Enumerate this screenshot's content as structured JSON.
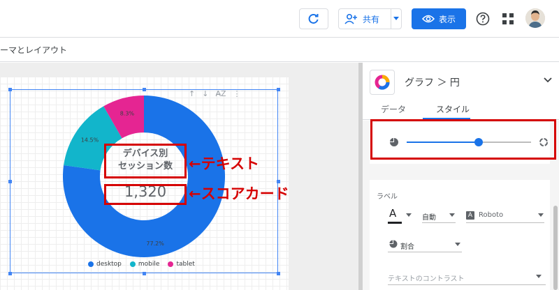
{
  "toolbar": {
    "share_label": "共有",
    "view_label": "表示"
  },
  "menubar": {
    "theme_label": "ーマとレイアウト"
  },
  "chart_data": {
    "type": "pie",
    "donut": true,
    "categories": [
      "desktop",
      "mobile",
      "tablet"
    ],
    "values": [
      77.2,
      14.5,
      8.3
    ],
    "data_labels": [
      "77.2%",
      "14.5%",
      "8.3%"
    ],
    "colors": [
      "#1a73e8",
      "#12b5cb",
      "#e52592"
    ],
    "legend_position": "bottom"
  },
  "chart_overlay": {
    "center_text_line1": "デバイス別",
    "center_text_line2": "セッション数",
    "scorecard_value": "1,320"
  },
  "annotations": {
    "text_label": "←テキスト",
    "scorecard_label": "←スコアカード",
    "color": "#d50000"
  },
  "panel": {
    "chart_type_label": "グラフ ＞ 円",
    "tabs": [
      "データ",
      "スタイル"
    ],
    "active_tab": "スタイル",
    "donut_slider_fraction": 0.58,
    "label_section_title": "ラベル",
    "font_color_letter": "A",
    "font_size_value": "自動",
    "font_family_icon_letter": "A",
    "font_family_value": "Roboto",
    "label_type_value": "割合",
    "text_contrast_placeholder": "テキストのコントラスト"
  }
}
